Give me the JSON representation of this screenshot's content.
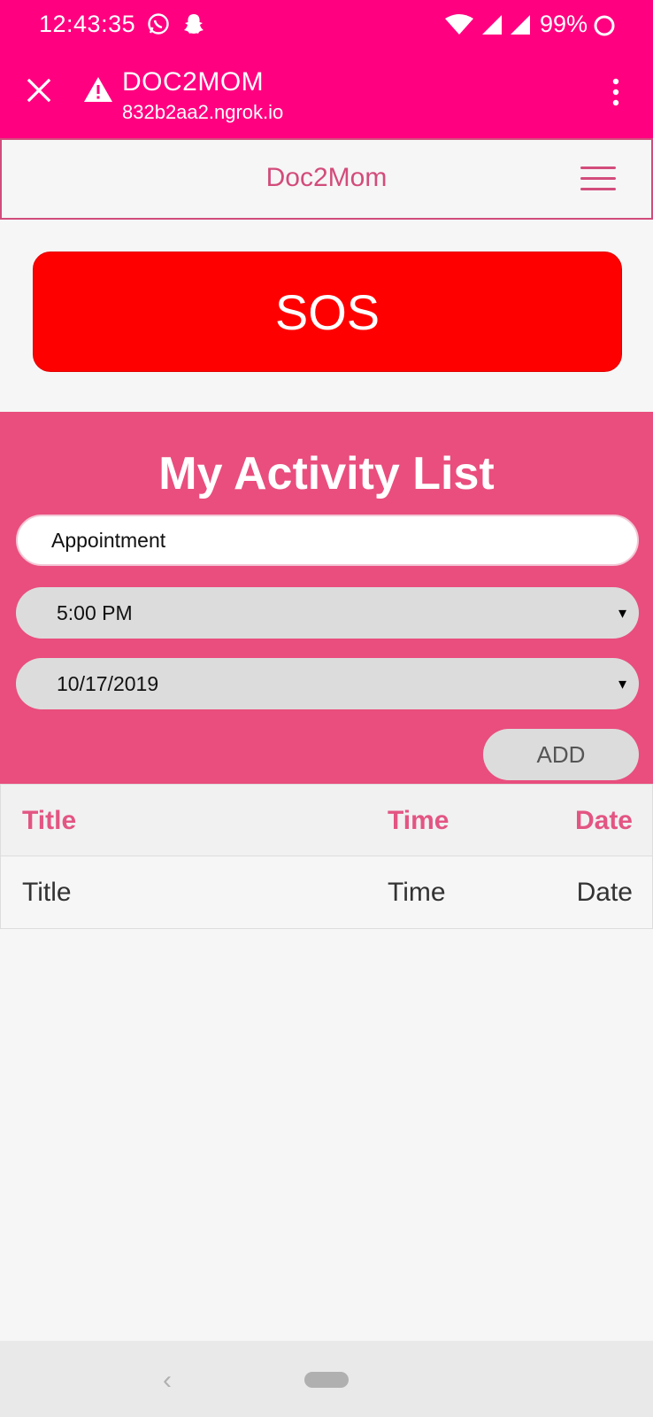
{
  "status_bar": {
    "time": "12:43:35",
    "battery": "99%",
    "icons": [
      "whatsapp-icon",
      "snapchat-icon",
      "wifi-icon",
      "signal-icon",
      "signal-icon",
      "battery-circle-icon"
    ]
  },
  "browser": {
    "title": "DOC2MOM",
    "url": "832b2aa2.ngrok.io",
    "icons": [
      "close-icon",
      "warning-icon",
      "more-vert-icon"
    ]
  },
  "navbar": {
    "brand": "Doc2Mom",
    "menu_icon": "hamburger-icon"
  },
  "sos": {
    "label": "SOS"
  },
  "activity": {
    "heading": "My Activity List",
    "title_value": "Appointment",
    "time_value": "5:00 PM",
    "date_value": "10/17/2019",
    "dropdown_glyph": "▾",
    "add_label": "ADD"
  },
  "table": {
    "headers": [
      "Title",
      "Time",
      "Date"
    ],
    "rows": [
      [
        "Title",
        "Time",
        "Date"
      ]
    ]
  },
  "system_nav": {
    "back_glyph": "‹",
    "icons": [
      "back-icon",
      "home-pill-icon"
    ]
  },
  "colors": {
    "chrome": "#ff0080",
    "accent": "#e94e7e",
    "sos": "#ff0000",
    "brand_text": "#d24c7b"
  }
}
